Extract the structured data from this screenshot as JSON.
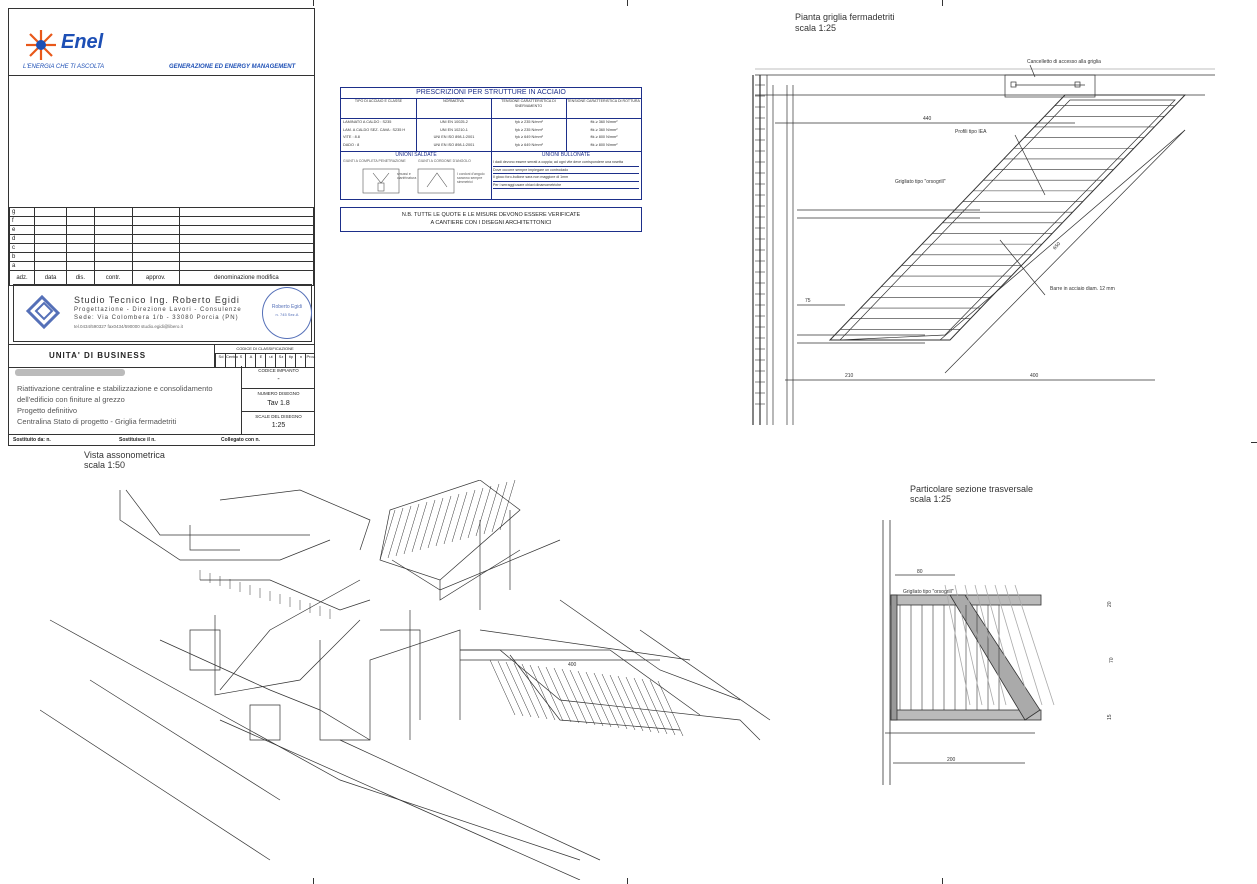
{
  "enel": {
    "logo": "Enel",
    "tagline": "L'ENERGIA CHE TI ASCOLTA",
    "division": "GENERAZIONE ED ENERGY MANAGEMENT"
  },
  "revisions": {
    "rows": [
      "g",
      "f",
      "e",
      "d",
      "c",
      "b",
      "a"
    ],
    "headers": [
      "adz.",
      "data",
      "dis.",
      "contr.",
      "approv.",
      "denominazione modifica"
    ]
  },
  "studio": {
    "name": "Studio Tecnico Ing. Roberto Egidi",
    "services": "Progettazione - Direzione Lavori - Consulenze",
    "address": "Sede: Via Colombera 1/b - 33080 Porcia (PN)",
    "contacts": "tel.0434/590327 fax0434/590000 studio.egidi@libero.it",
    "stamp_name": "Roberto Egidi",
    "stamp_id": "n. 745 Sez.A"
  },
  "business": {
    "unit_label": "UNITA' DI BUSINESS",
    "codice_label": "CODICE DI CLASSIFICAZIONE",
    "code_cols": [
      "Sd",
      "Centro",
      "S",
      "A",
      "E",
      "ut",
      "Sz",
      "tip",
      "n",
      "Prov."
    ],
    "codice_impianto": "CODICE IMPIANTO",
    "codice_value": "-",
    "numero_label": "NUMERO DISEGNO",
    "numero_value": "Tav 1.8",
    "scala_label": "SCALE DEL DISEGNO",
    "scala_value": "1:25",
    "sostituito_da": "Sostituito da: n.",
    "sostituisce": "Sostituisce il n.",
    "collegato": "Collegato con n."
  },
  "project": {
    "line1": "Riattivazione centraline e stabilizzazione e consolidamento",
    "line2": "dell'edificio con finiture al grezzo",
    "line3": "Progetto definitivo",
    "line4": "Centralina Stato di progetto - Griglia fermadetriti"
  },
  "prescriptions": {
    "title": "PRESCRIZIONI PER STRUTTURE IN ACCIAIO",
    "headers": [
      "TIPO DI ACCIAIO E CLASSE",
      "NORMATIVA",
      "TENSIONE CARATTERISTICA DI SNERVAMENTO",
      "TENSIONE CARATTERISTICA DI ROTTURA"
    ],
    "rows": [
      [
        "LAMINATO A CALDO : S235",
        "UNI EN 10025-2",
        "fyk ≥ 235 N/mm²",
        "ftk ≥ 360 N/mm²"
      ],
      [
        "LAM. A CALDO SEZ. CAVA : S235 H",
        "UNI EN 10210-1",
        "fyk ≥ 235 N/mm²",
        "ftk ≥ 360 N/mm²"
      ],
      [
        "VITE : 8.8",
        "UNI EN ISO 898-1:2001",
        "fyk ≥ 649 N/mm²",
        "ftk ≥ 800 N/mm²"
      ],
      [
        "DADO : 8",
        "UNI EN ISO 898-1:2001",
        "fyk ≥ 649 N/mm²",
        "ftk ≥ 800 N/mm²"
      ]
    ],
    "welded_title": "UNIONI SALDATE",
    "bolted_title": "UNIONI BULLONATE",
    "welded_sub1": "GIUNTI A COMPLETA PENETRAZIONE",
    "welded_sub2": "GIUNTI A CORDONE D'ANGOLO",
    "welded_note1": "smussi e cianfrinatura",
    "welded_note2": "I cordoni d'angolo saranno sempre simmetrici",
    "bolted_notes": [
      "I dadi devono essere serrati a coppia; ad ogni vite deve corrispondere una rosetta",
      "Dove occorre sempre impiegare un controdado",
      "Il gioco foro-bullone sara non maggiore di 1mm",
      "Per i serraggi usare chiavi dinamometriche"
    ],
    "nb_line1": "N.B. TUTTE LE QUOTE E LE MISURE DEVONO ESSERE VERIFICATE",
    "nb_line2": "A CANTIERE CON I DISEGNI ARCHITETTONICI"
  },
  "plan": {
    "title": "Pianta griglia fermadetriti",
    "scale": "scala 1:25",
    "cancelletto": "Cancelletto di accesso alla griglia",
    "profili": "Profili tipo IEA",
    "grigliato": "Grigliato tipo \"orsogrill\"",
    "barre": "Barre in acciaio diam. 12 mm",
    "dims": [
      "440",
      "75",
      "210",
      "400",
      "650"
    ]
  },
  "axo": {
    "title": "Vista assonometrica",
    "scale": "scala 1:50",
    "dim": "400"
  },
  "section": {
    "title": "Particolare sezione trasversale",
    "scale": "scala 1:25",
    "grigliato": "Grigliato tipo \"orsogrill\"",
    "dims": [
      "80",
      "200",
      "20",
      "70",
      "15"
    ]
  }
}
